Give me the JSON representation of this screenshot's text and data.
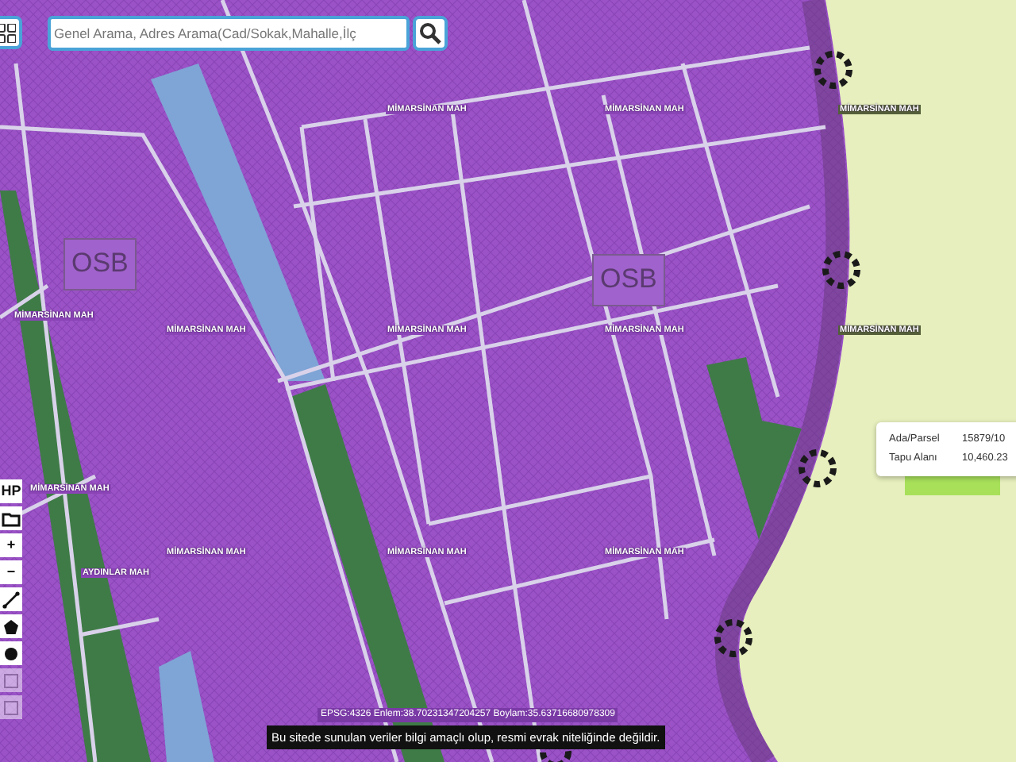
{
  "search": {
    "placeholder": "Genel Arama, Adres Arama(Cad/Sokak,Mahalle,İlç"
  },
  "map_labels": [
    {
      "kind": "district",
      "text": "MİMARSİNAN MAH"
    },
    {
      "kind": "district",
      "text": "MİMARSİNAN MAH"
    },
    {
      "kind": "district",
      "text": "MİMARSİNAN MAH"
    },
    {
      "kind": "zone",
      "text": "OSB"
    },
    {
      "kind": "district",
      "text": "MİMARSİNAN MAH"
    },
    {
      "kind": "district",
      "text": "MİMARSİNAN MAH"
    },
    {
      "kind": "district",
      "text": "MİMARSİNAN MAH"
    },
    {
      "kind": "zone",
      "text": "OSB"
    },
    {
      "kind": "district",
      "text": "MİMARSİNAN MAH"
    },
    {
      "kind": "district",
      "text": "MİMARSİNAN MAH"
    },
    {
      "kind": "district",
      "text": "MİMARSİNAN MAH"
    },
    {
      "kind": "district",
      "text": "MİMARSİNAN MAH"
    },
    {
      "kind": "district",
      "text": "MİMARSİNAN MAH"
    },
    {
      "kind": "district",
      "text": "MİMARSİNAN MAH"
    },
    {
      "kind": "district",
      "text": "AYDINLAR MAH"
    }
  ],
  "parcel_popup": {
    "rows": [
      {
        "label": "Ada/Parsel",
        "value": "15879/10"
      },
      {
        "label": "Tapu Alanı",
        "value": "10,460.23"
      }
    ]
  },
  "toolbar": [
    {
      "kind": "text",
      "text": "HP"
    },
    {
      "kind": "folder"
    },
    {
      "kind": "text",
      "text": "+"
    },
    {
      "kind": "text",
      "text": "−"
    },
    {
      "kind": "line"
    },
    {
      "kind": "polygon"
    },
    {
      "kind": "point"
    },
    {
      "kind": "disabled"
    },
    {
      "kind": "disabled"
    }
  ],
  "coordinates": "EPSG:4326 Enlem:38.70231347204257 Boylam:35.63716680978309",
  "disclaimer": "Bu sitede sunulan veriler bilgi amaçlı olup, resmi evrak niteliğinde değildir."
}
